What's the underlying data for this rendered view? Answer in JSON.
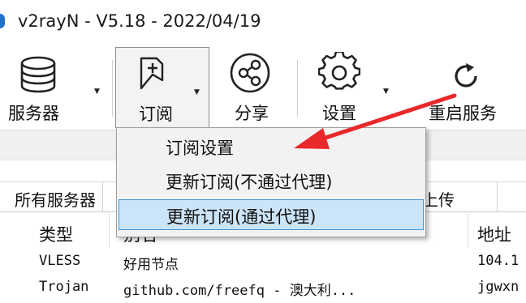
{
  "window": {
    "title": "v2rayN - V5.18 - 2022/04/19"
  },
  "toolbar": {
    "servers_label": "服务器",
    "subscription_label": "订阅",
    "share_label": "分享",
    "settings_label": "设置",
    "restart_label": "重启服务"
  },
  "subscription_menu": {
    "items": [
      "订阅设置",
      "更新订阅(不通过代理)",
      "更新订阅(通过代理)"
    ],
    "highlighted_index": 2
  },
  "tabs": {
    "all_servers": "所有服务器",
    "partial_visible": "上传"
  },
  "table": {
    "headers": [
      "类型",
      "别名",
      "地址"
    ],
    "rows": [
      {
        "type": "VLESS",
        "alias": "好用节点",
        "address": "104.1"
      },
      {
        "type": "Trojan",
        "alias": "github.com/freefq - 澳大利...",
        "address": "jgwxn"
      }
    ]
  },
  "colors": {
    "annotation_arrow": "#e8282b",
    "menu_highlight": "#cce4f7",
    "menu_highlight_border": "#3f94d8",
    "app_icon": "#1e73c8"
  }
}
